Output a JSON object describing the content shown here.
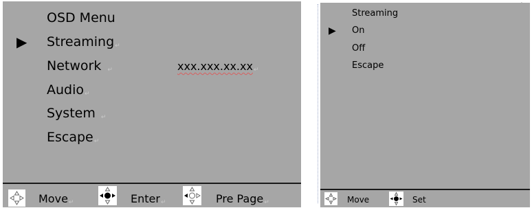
{
  "left_menu": {
    "title": "OSD Menu",
    "items": [
      {
        "label": "Streaming",
        "selected": true
      },
      {
        "label": "Network",
        "value": "xxx.xxx.xx.xx"
      },
      {
        "label": "Audio"
      },
      {
        "label": "System"
      },
      {
        "label": "Escape"
      }
    ],
    "status_bar": [
      {
        "icon": "dpad-move-icon",
        "label": "Move"
      },
      {
        "icon": "dpad-enter-icon",
        "label": "Enter"
      },
      {
        "icon": "dpad-pre-page-icon",
        "label": "Pre Page"
      }
    ]
  },
  "right_menu": {
    "title": "Streaming",
    "items": [
      {
        "label": "On",
        "selected": true
      },
      {
        "label": "Off"
      },
      {
        "label": "Escape"
      }
    ],
    "status_bar": [
      {
        "icon": "dpad-move-icon",
        "label": "Move"
      },
      {
        "icon": "dpad-set-icon",
        "label": "Set"
      }
    ]
  },
  "glyphs": {
    "selection_arrow": "▶",
    "paragraph_mark": "↵"
  },
  "colors": {
    "panel_background": "#a6a6a6",
    "text": "#000000",
    "divider": "#1a1a1a",
    "icon_background": "#ffffff"
  }
}
